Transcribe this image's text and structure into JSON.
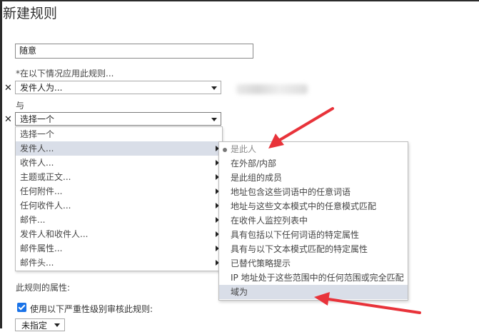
{
  "page": {
    "title": "新建规则",
    "name_value": "随意",
    "apply_label": "*在以下情况应用此规则...",
    "condition1": {
      "value": "发件人为..."
    },
    "and_label": "与",
    "condition2": {
      "value": "选择一个"
    },
    "properties_label": "此规则的属性:",
    "audit_label": "使用以下严重性级别审核此规则:",
    "severity_value": "未指定"
  },
  "dropdown": {
    "items": [
      {
        "label": "选择一个",
        "has_submenu": false
      },
      {
        "label": "发件人...",
        "has_submenu": true,
        "highlighted": true
      },
      {
        "label": "收件人...",
        "has_submenu": true
      },
      {
        "label": "主题或正文...",
        "has_submenu": true
      },
      {
        "label": "任何附件...",
        "has_submenu": true
      },
      {
        "label": "任何收件人...",
        "has_submenu": true
      },
      {
        "label": "邮件...",
        "has_submenu": true
      },
      {
        "label": "发件人和收件人...",
        "has_submenu": true
      },
      {
        "label": "邮件属性...",
        "has_submenu": true
      },
      {
        "label": "邮件头...",
        "has_submenu": true
      }
    ]
  },
  "submenu": {
    "items": [
      {
        "label": "是此人",
        "selected": true
      },
      {
        "label": "在外部/内部"
      },
      {
        "label": "是此组的成员"
      },
      {
        "label": "地址包含这些词语中的任意词语"
      },
      {
        "label": "地址与这些文本模式中的任意模式匹配"
      },
      {
        "label": "在收件人监控列表中"
      },
      {
        "label": "具有包括以下任何词语的特定属性"
      },
      {
        "label": "具有与以下文本模式匹配的特定属性"
      },
      {
        "label": "已替代策略提示"
      },
      {
        "label": "IP 地址处于这些范围中的任何范围或完全匹配"
      },
      {
        "label": "域为",
        "highlighted": true
      }
    ]
  },
  "colors": {
    "annotation_arrow": "#e8333a",
    "checkbox": "#1a73e8",
    "highlight": "#d9dee8"
  }
}
